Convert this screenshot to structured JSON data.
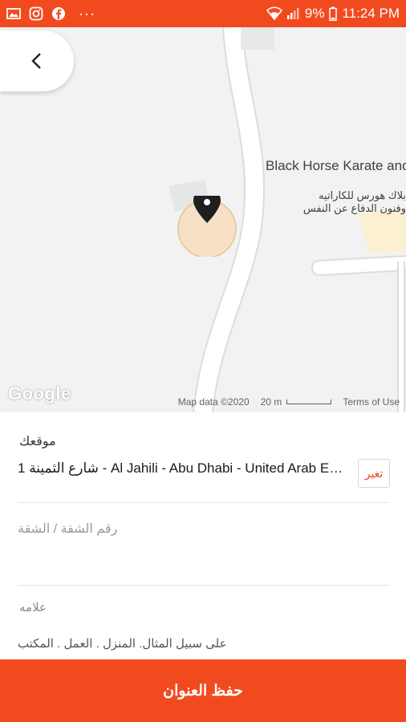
{
  "status_bar": {
    "battery": "9%",
    "time": "11:24 PM",
    "dots": "···",
    "icons": [
      "gallery-icon",
      "instagram-icon",
      "facebook-icon",
      "wifi-icon",
      "signal-icon",
      "battery-icon"
    ]
  },
  "map": {
    "poi_name_en": "Black Horse Karate and Martial Arts",
    "poi_name_ar_line1": "بلاك هورس للكاراتيه",
    "poi_name_ar_line2": "وفنون الدفاع عن النفس",
    "google_logo": "Google",
    "map_data": "Map data ©2020",
    "scale": "20 m",
    "terms": "Terms of Use"
  },
  "form": {
    "location_label": "موقعك",
    "location_value": "1 شارع الثمينة - Al Jahili - Abu Dhabi - United Arab Emirates",
    "change_button": "تغير",
    "apartment_placeholder": "رقم الشقة / الشقة",
    "label_title": "علامه",
    "label_placeholder": "على سبيل المثال. المنزل . العمل . المكتب"
  },
  "save_button": "حفظ العنوان",
  "colors": {
    "accent": "#f24a1f",
    "map_bg": "#f2f2f2",
    "pin_circle": "#f6e1c7",
    "pin_border": "#e7c48e"
  }
}
